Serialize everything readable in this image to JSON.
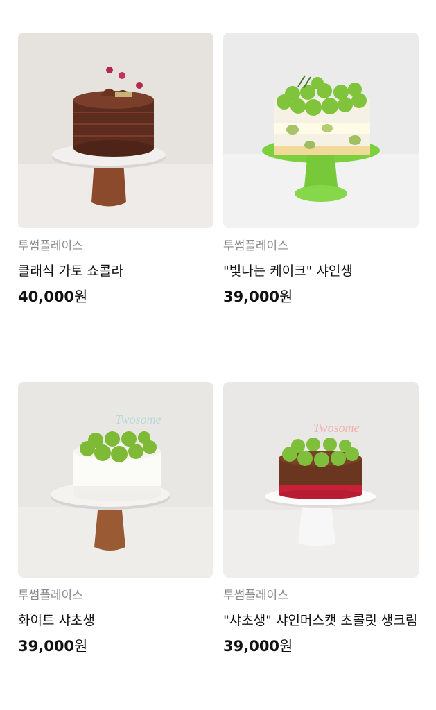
{
  "products": [
    {
      "brand": "투썸플레이스",
      "name": "클래식 가토 쇼콜라",
      "price": "40,000",
      "currency": "원",
      "image_icon": "chocolate-cake-image"
    },
    {
      "brand": "투썸플레이스",
      "name": "\"빛나는 케이크\" 샤인생",
      "price": "39,000",
      "currency": "원",
      "image_icon": "shine-muscat-cake-image"
    },
    {
      "brand": "투썸플레이스",
      "name": "화이트 샤초생",
      "price": "39,000",
      "currency": "원",
      "image_icon": "white-muscat-cake-image"
    },
    {
      "brand": "투썸플레이스",
      "name": "\"샤초생\" 샤인머스캣 초콜릿 생크림",
      "price": "39,000",
      "currency": "원",
      "image_icon": "chocolate-muscat-cake-image"
    }
  ]
}
